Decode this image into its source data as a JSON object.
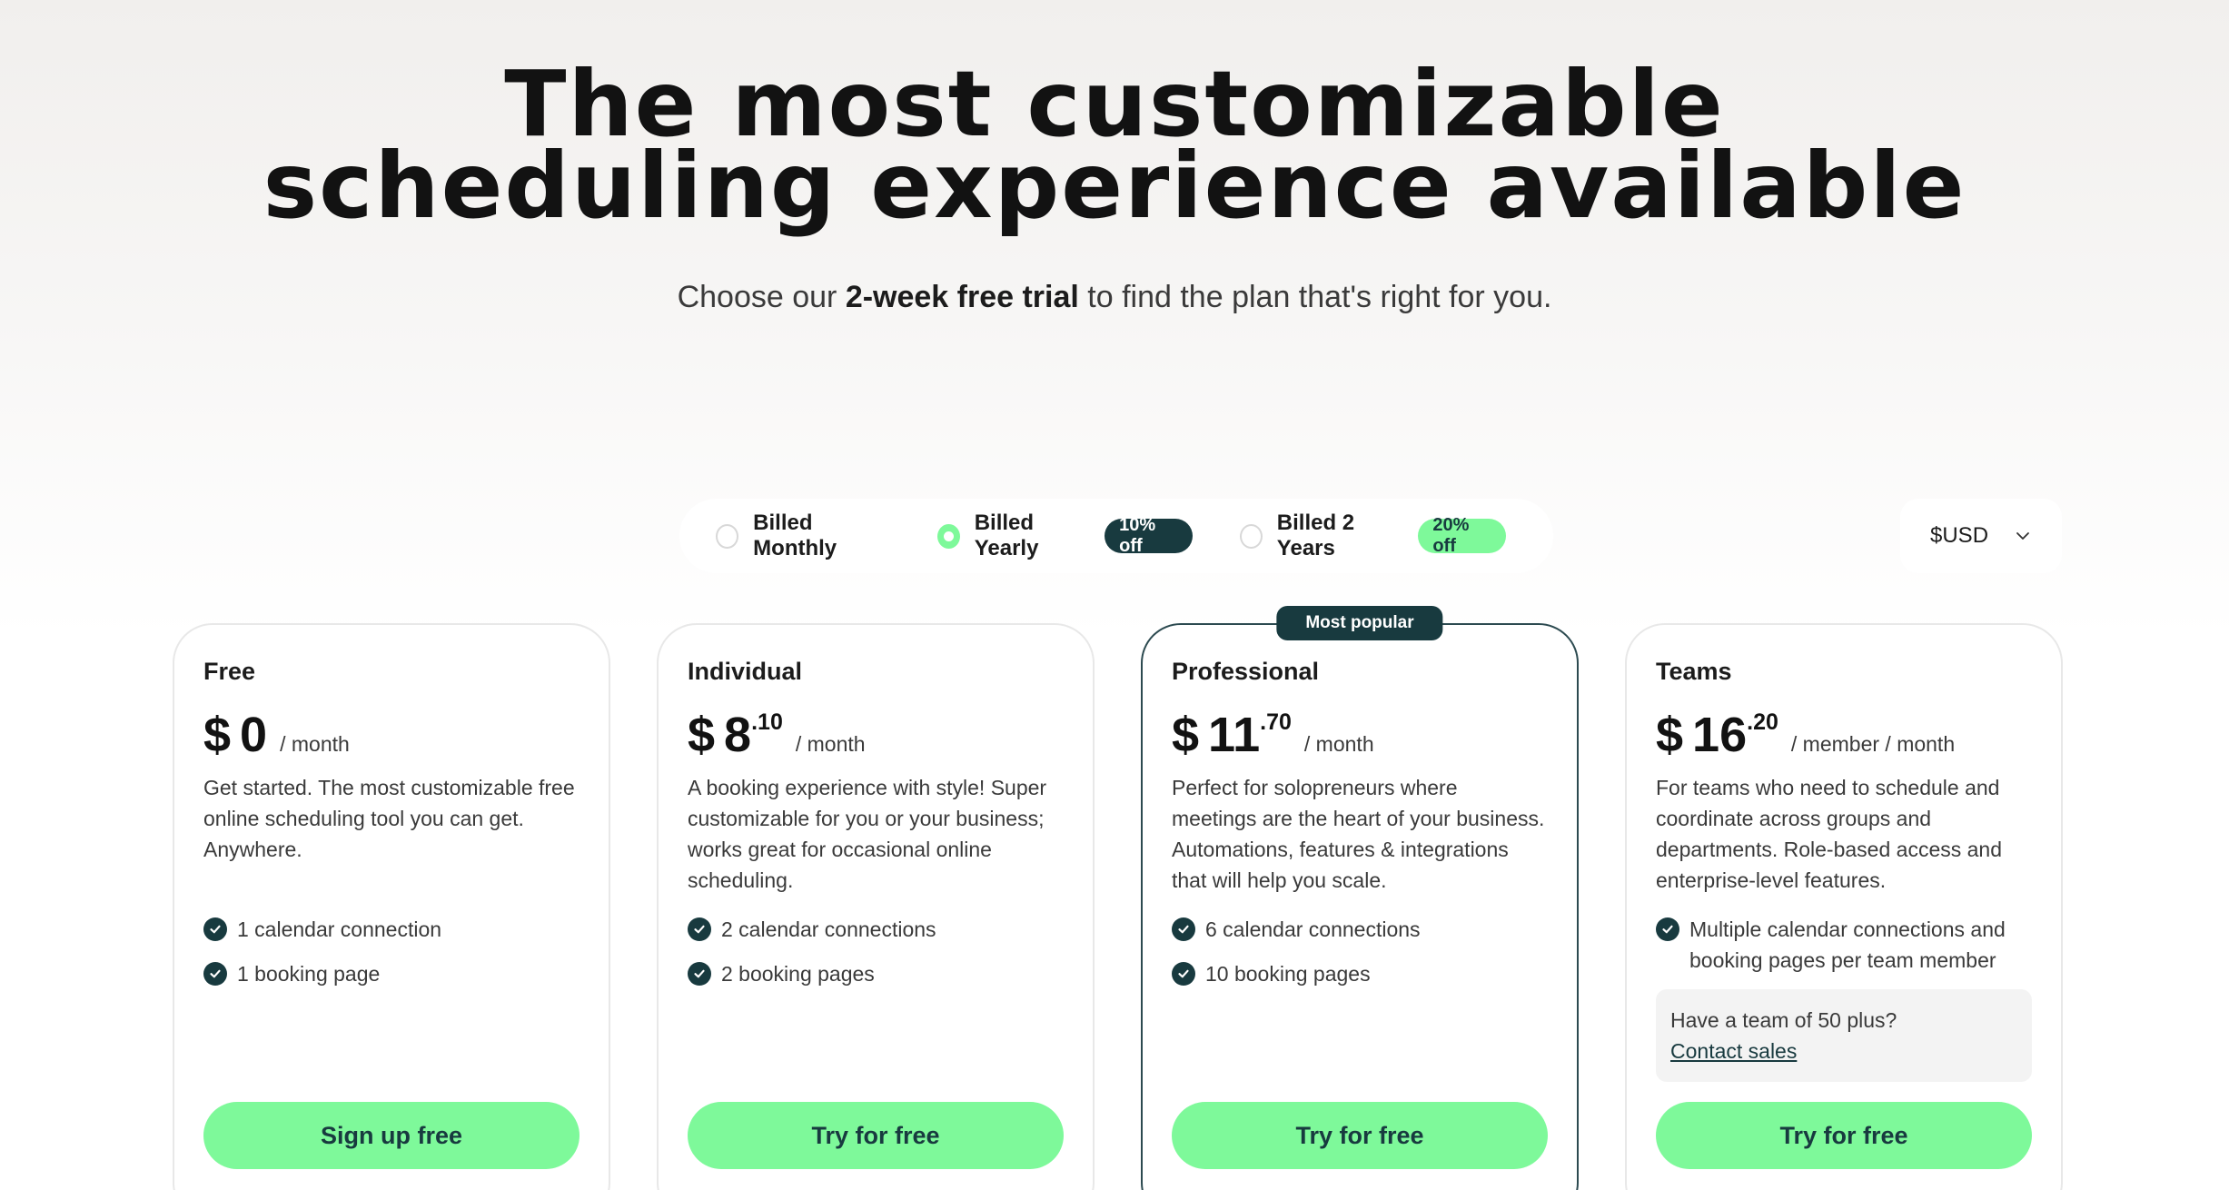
{
  "hero": {
    "title_line1": "The most customizable",
    "title_line2": "scheduling experience available",
    "subtitle_pre": "Choose our ",
    "subtitle_bold": "2-week free trial",
    "subtitle_post": " to find the plan that's right for you."
  },
  "billing": {
    "options": [
      {
        "label": "Billed Monthly",
        "selected": false,
        "badge": ""
      },
      {
        "label": "Billed Yearly",
        "selected": true,
        "badge": "10% off"
      },
      {
        "label": "Billed 2 Years",
        "selected": false,
        "badge": "20% off"
      }
    ]
  },
  "currency": {
    "label": "$USD",
    "icon": "chevron-down-icon"
  },
  "plans": [
    {
      "name": "Free",
      "currency_symbol": "$",
      "amount": "0",
      "cents": "",
      "period": "/ month",
      "description": "Get started. The most customizable free online scheduling tool you can get. Anywhere.",
      "features": [
        "1 calendar connection",
        "1 booking page"
      ],
      "cta": "Sign up free"
    },
    {
      "name": "Individual",
      "currency_symbol": "$",
      "amount": "8",
      "cents": ".10",
      "period": "/ month",
      "description": "A booking experience with style! Super customizable for you or your business; works great for occasional online scheduling.",
      "features": [
        "2 calendar connections",
        "2 booking pages"
      ],
      "cta": "Try for free"
    },
    {
      "name": "Professional",
      "badge": "Most popular",
      "currency_symbol": "$",
      "amount": "11",
      "cents": ".70",
      "period": "/ month",
      "description": "Perfect for solopreneurs where meetings are the heart of your business. Automations, features & integrations that will help you scale.",
      "features": [
        "6 calendar connections",
        "10 booking pages"
      ],
      "cta": "Try for free"
    },
    {
      "name": "Teams",
      "currency_symbol": "$",
      "amount": "16",
      "cents": ".20",
      "period": "/ member / month",
      "description": "For teams who need to schedule and coordinate across groups and departments. Role-based access and enterprise-level features.",
      "features": [
        "Multiple calendar connections and booking pages per team member"
      ],
      "contact_text": "Have a team of 50 plus?",
      "contact_link": "Contact sales",
      "cta": "Try for free"
    }
  ],
  "colors": {
    "accent_green": "#7ef99a",
    "dark_teal": "#183a3f"
  }
}
